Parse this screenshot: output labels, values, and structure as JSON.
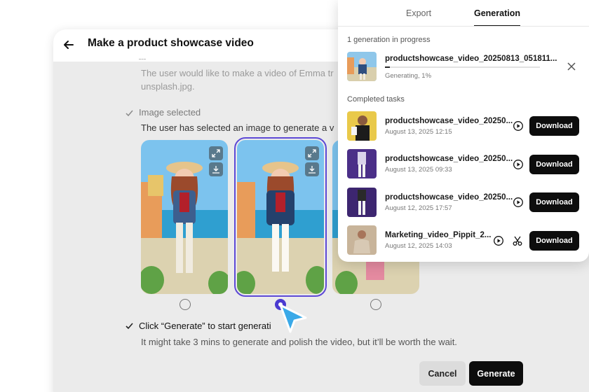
{
  "main": {
    "title": "Make a product showcase video",
    "faded_line1": "The user would like to make a video of Emma tr",
    "faded_line2": "unsplash.jpg.",
    "check_mark_icon": "check-icon",
    "image_selected": "Image selected",
    "image_selected_desc": "The user has selected an image to generate a v",
    "step_generate": "Click “Generate” to start generati",
    "step_generate_desc": "It might take 3 mins to generate and polish the video, but it’ll be worth the wait.",
    "cancel_label": "Cancel",
    "generate_label": "Generate",
    "selected_image_index": 2,
    "accent_color": "#5d49d6"
  },
  "panel": {
    "tabs": [
      {
        "label": "Export",
        "active": false
      },
      {
        "label": "Generation",
        "active": true
      }
    ],
    "in_progress_label": "1 generation in progress",
    "in_progress": {
      "name": "productshowcase_video_20250813_051811...",
      "status": "Generating, 1%",
      "progress": 0.01
    },
    "completed_label": "Completed tasks",
    "completed": [
      {
        "name": "productshowcase_video_20250...",
        "date": "August 13, 2025 12:15",
        "download": "Download"
      },
      {
        "name": "productshowcase_video_20250...",
        "date": "August 13, 2025 09:33",
        "download": "Download"
      },
      {
        "name": "productshowcase_video_20250...",
        "date": "August 12, 2025 17:57",
        "download": "Download"
      },
      {
        "name": "Marketing_video_Pippit_2...",
        "date": "August 12, 2025 14:03",
        "download": "Download"
      }
    ]
  }
}
